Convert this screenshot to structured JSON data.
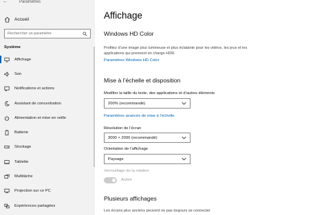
{
  "window": {
    "title": "Paramètres"
  },
  "sidebar": {
    "home_label": "Accueil",
    "search_placeholder": "Rechercher un paramètre",
    "section_label": "Système",
    "items": [
      {
        "label": "Affichage",
        "icon": "monitor-icon"
      },
      {
        "label": "Son",
        "icon": "speaker-icon"
      },
      {
        "label": "Notifications et actions",
        "icon": "notifications-icon"
      },
      {
        "label": "Assistant de concentration",
        "icon": "moon-icon"
      },
      {
        "label": "Alimentation et mise en veille",
        "icon": "power-icon"
      },
      {
        "label": "Batterie",
        "icon": "battery-icon"
      },
      {
        "label": "Stockage",
        "icon": "storage-icon"
      },
      {
        "label": "Tablette",
        "icon": "tablet-icon"
      },
      {
        "label": "Multitâche",
        "icon": "multitask-icon"
      },
      {
        "label": "Projection sur ce PC",
        "icon": "projection-icon"
      },
      {
        "label": "Expériences partagées",
        "icon": "shared-icon"
      }
    ]
  },
  "main": {
    "page_title": "Affichage",
    "hdr": {
      "heading": "Windows HD Color",
      "description": "Profitez d’une image plus lumineuse et plus éclatante pour les vidéos, les jeux et les applications qui prennent en charge HDR.",
      "link": "Paramètres Windows HD Color"
    },
    "scale": {
      "heading": "Mise à l’échelle et disposition",
      "text_size_label": "Modifier la taille du texte, des applications et d’autres éléments",
      "text_size_value": "200% (recommandé)",
      "advanced_link": "Paramètres avancés de mise à l’échelle",
      "resolution_label": "Résolution de l’écran",
      "resolution_value": "3000 × 2000 (recommandé)",
      "orientation_label": "Orientation de l’affichage",
      "orientation_value": "Paysage",
      "rotation_lock_label": "Verrouillage de la rotation",
      "rotation_lock_state": "Active"
    },
    "multiple": {
      "heading": "Plusieurs affichages",
      "description": "Les écrans plus anciens peuvent ne pas toujours se connecter"
    }
  }
}
